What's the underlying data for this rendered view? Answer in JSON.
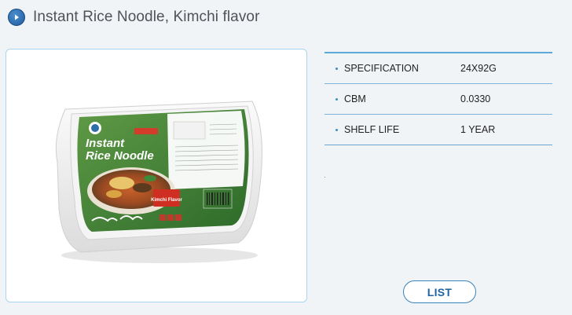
{
  "header": {
    "icon": "play-arrow-icon",
    "title": "Instant Rice Noodle,  Kimchi flavor"
  },
  "product_image": {
    "alt": "",
    "package": {
      "brand_line1": "Instant",
      "brand_line2": "Rice Noodle",
      "flavor_tag": "Kimchi Flavor"
    }
  },
  "specs": [
    {
      "label": "SPECIFICATION",
      "value": "24X92G"
    },
    {
      "label": "CBM",
      "value": "0.0330"
    },
    {
      "label": "SHELF LIFE",
      "value": "1 YEAR"
    }
  ],
  "list_button": {
    "label": "LIST"
  },
  "colors": {
    "accent": "#3a84bd",
    "border": "#a9d3ee",
    "package_green": "#3f7d33"
  }
}
